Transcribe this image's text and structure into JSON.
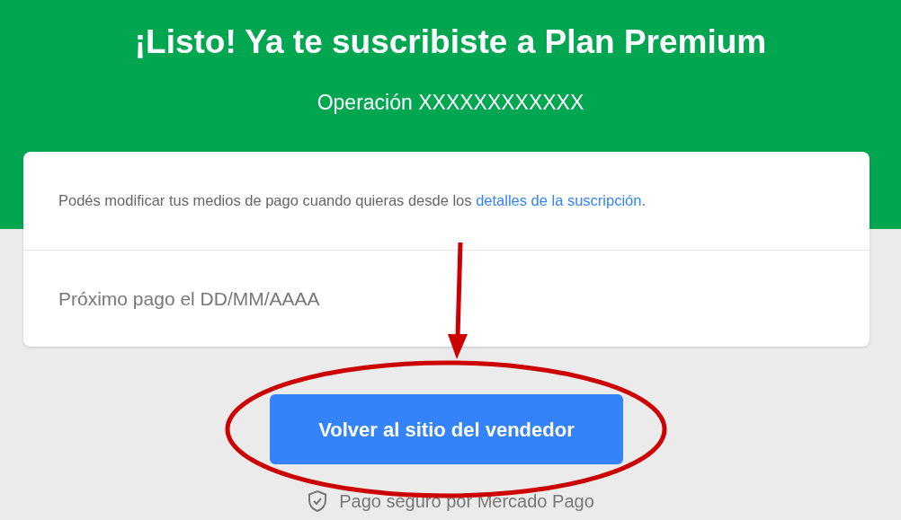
{
  "header": {
    "title": "¡Listo! Ya te suscribiste a Plan Premium",
    "operation": "Operación XXXXXXXXXXXX"
  },
  "card": {
    "notice": {
      "text": "Podés modificar tus medios de pago cuando quieras desde los ",
      "link": "detalles de la suscripción",
      "suffix": "."
    },
    "next_payment": "Próximo pago el DD/MM/AAAA"
  },
  "button": "Volver al sitio del vendedor",
  "footer": "Pago seguro por Mercado Pago"
}
